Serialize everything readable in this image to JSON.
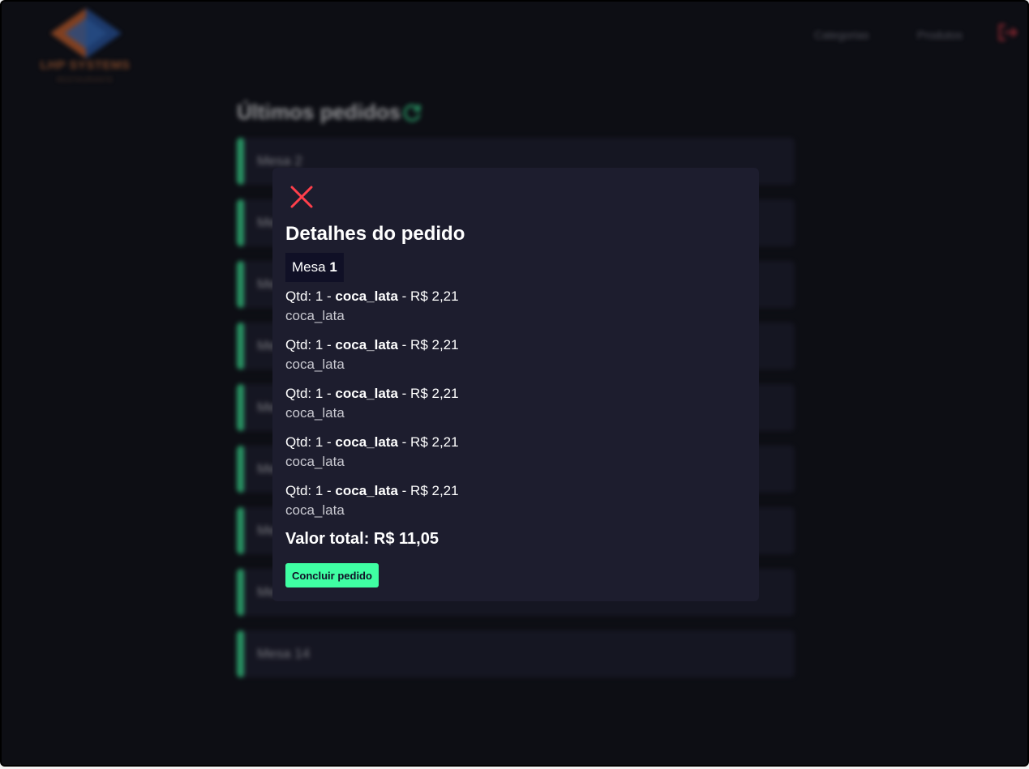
{
  "header": {
    "logo_name": "LHP SYSTEMS",
    "logo_tagline": "RESTAURANTE",
    "nav": [
      "Categorias",
      "Produtos"
    ]
  },
  "orders": {
    "title": "Últimos pedidos",
    "rows": [
      "Mesa 2",
      "Mesa",
      "Mesa",
      "Mesa",
      "Mesa",
      "Mesa",
      "Mesa",
      "Mesa",
      "Mesa 14"
    ]
  },
  "modal": {
    "title": "Detalhes do pedido",
    "table_prefix": "Mesa",
    "table_number": "1",
    "items": [
      {
        "qty_label": "Qtd: 1 -",
        "name": "coca_lata",
        "price": "- R$ 2,21",
        "description": "coca_lata"
      },
      {
        "qty_label": "Qtd: 1 -",
        "name": "coca_lata",
        "price": "- R$ 2,21",
        "description": "coca_lata"
      },
      {
        "qty_label": "Qtd: 1 -",
        "name": "coca_lata",
        "price": "- R$ 2,21",
        "description": "coca_lata"
      },
      {
        "qty_label": "Qtd: 1 -",
        "name": "coca_lata",
        "price": "- R$ 2,21",
        "description": "coca_lata"
      },
      {
        "qty_label": "Qtd: 1 -",
        "name": "coca_lata",
        "price": "- R$ 2,21",
        "description": "coca_lata"
      }
    ],
    "total": "Valor total: R$ 11,05",
    "finish_button": "Concluir pedido"
  },
  "colors": {
    "background": "#0d0e14",
    "panel": "#1d1d2e",
    "accent_green": "#3fffa3",
    "close_red": "#ff3f4b",
    "badge_bg": "#101026"
  },
  "icons": {
    "close": "close-icon",
    "refresh": "refresh-icon",
    "logout": "logout-icon"
  }
}
